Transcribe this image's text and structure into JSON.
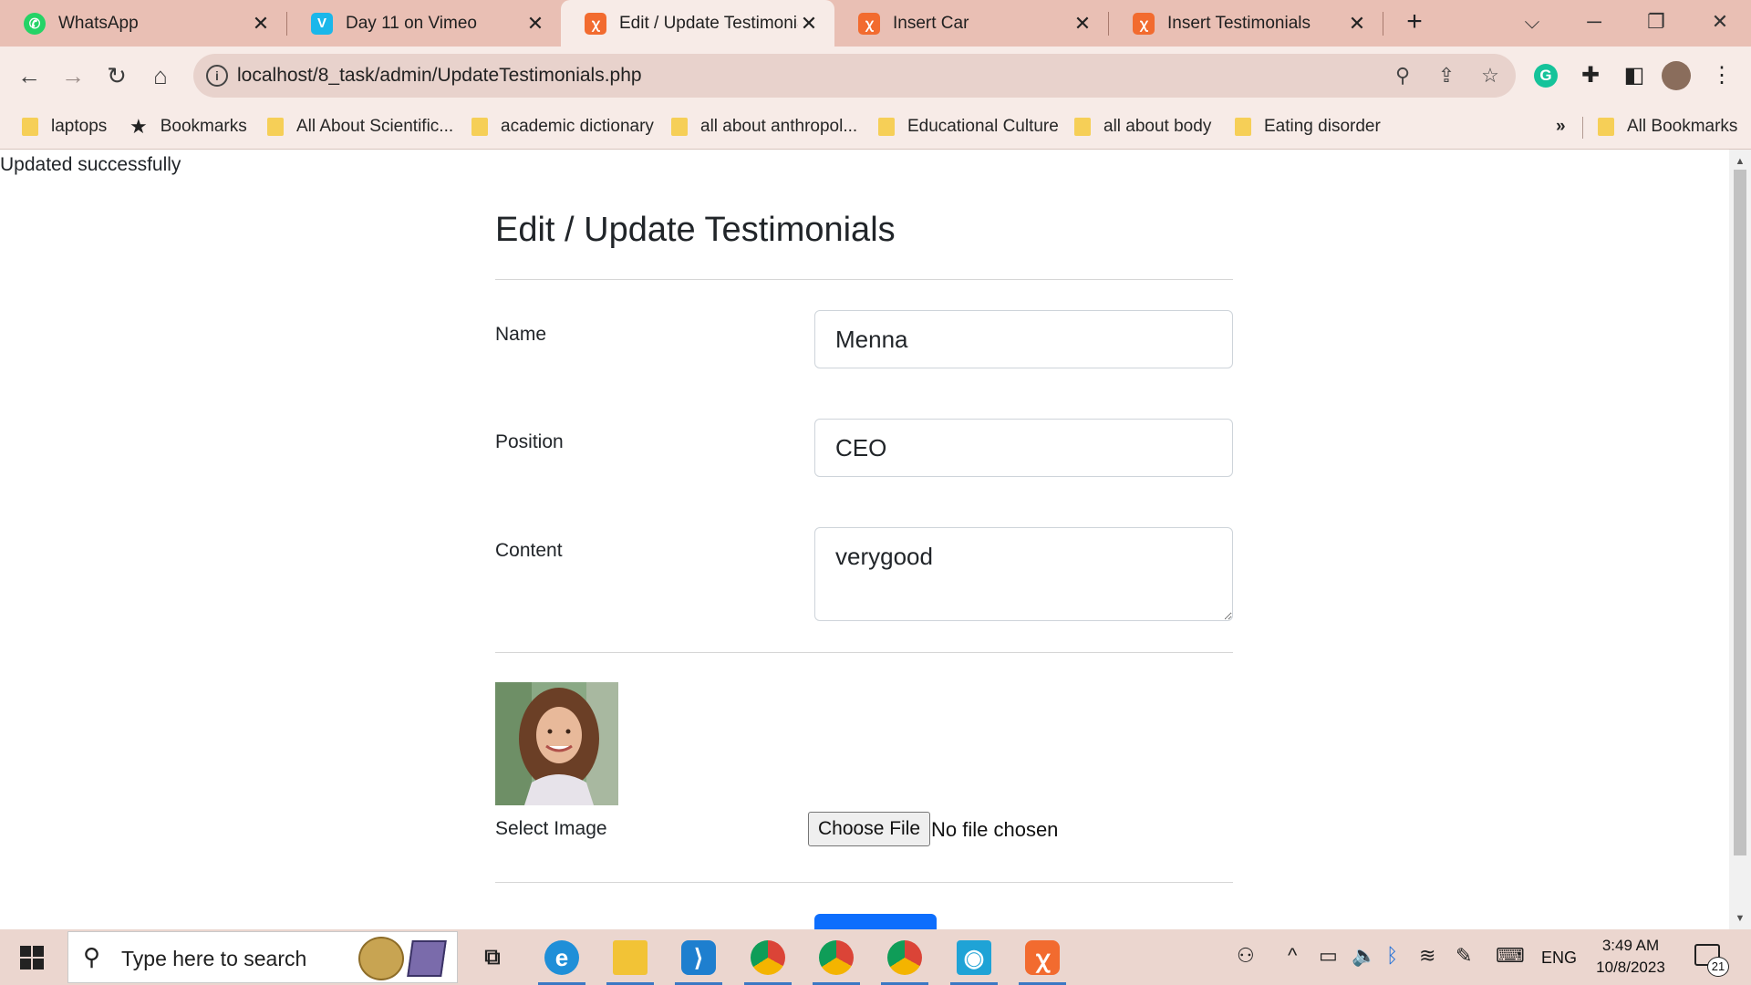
{
  "browser": {
    "tabs": [
      {
        "title": "WhatsApp",
        "icon": "whatsapp-icon",
        "active": false
      },
      {
        "title": "Day 11 on Vimeo",
        "icon": "vimeo-icon",
        "active": false
      },
      {
        "title": "Edit / Update Testimonials",
        "icon": "xampp-icon",
        "active": true
      },
      {
        "title": "Insert Car",
        "icon": "xampp-icon",
        "active": false
      },
      {
        "title": "Insert Testimonials",
        "icon": "xampp-icon",
        "active": false
      }
    ],
    "url": "localhost/8_task/admin/UpdateTestimonials.php",
    "bookmarks": [
      {
        "label": "laptops",
        "icon": "folder-icon"
      },
      {
        "label": "Bookmarks",
        "icon": "star-icon"
      },
      {
        "label": "All About Scientific...",
        "icon": "folder-icon"
      },
      {
        "label": "academic dictionary",
        "icon": "folder-icon"
      },
      {
        "label": "all about anthropol...",
        "icon": "folder-icon"
      },
      {
        "label": "Educational Culture",
        "icon": "folder-icon"
      },
      {
        "label": "all about body",
        "icon": "folder-icon"
      },
      {
        "label": "Eating disorder",
        "icon": "folder-icon"
      }
    ],
    "bookmarks_overflow": "»",
    "all_bookmarks": "All Bookmarks",
    "colors": {
      "frame": "#e9bfb4",
      "toolbar": "#f7ebe7",
      "omnibox": "#e8d2cc"
    }
  },
  "page": {
    "message": "Updated successfully",
    "title": "Edit / Update Testimonials",
    "form": {
      "name_label": "Name",
      "name_value": "Menna",
      "position_label": "Position",
      "position_value": "CEO",
      "content_label": "Content",
      "content_value": "verygood",
      "image_label": "Select Image",
      "choose_file": "Choose File",
      "no_file": "No file chosen"
    },
    "colors": {
      "primary": "#0d6efd"
    }
  },
  "taskbar": {
    "search_placeholder": "Type here to search",
    "apps": [
      "task-view-icon",
      "edge-icon",
      "file-explorer-icon",
      "vscode-icon",
      "chrome-icon",
      "chrome-icon",
      "chrome-icon",
      "browser-app-icon",
      "xampp-icon"
    ],
    "language": "ENG",
    "time": "3:49 AM",
    "date": "10/8/2023",
    "notifications": "21"
  }
}
